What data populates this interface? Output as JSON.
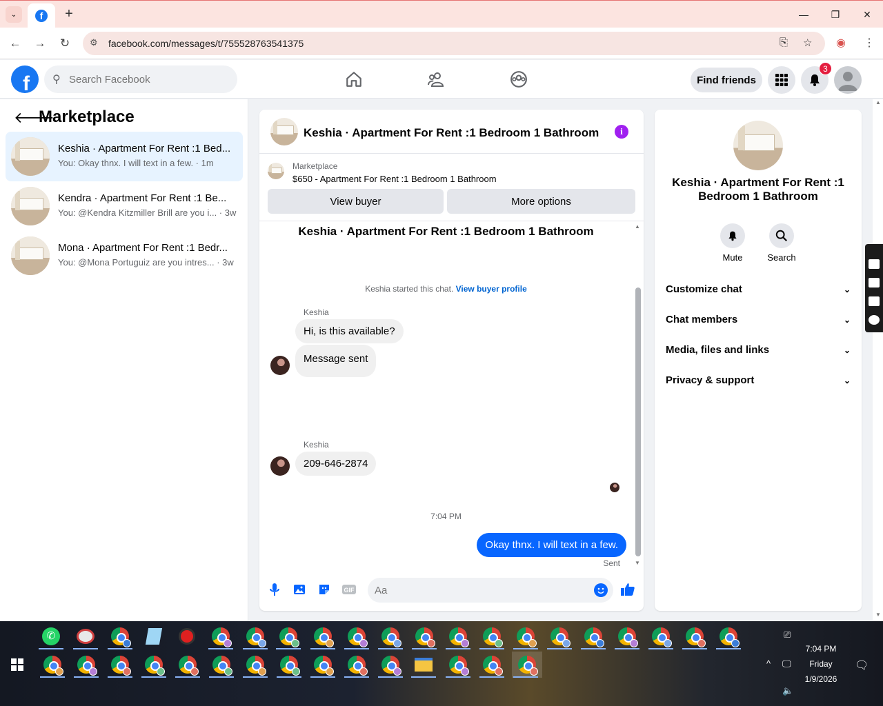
{
  "browser": {
    "url": "facebook.com/messages/t/755528763541375",
    "window_controls": [
      "—",
      "❐",
      "✕"
    ]
  },
  "header": {
    "search_placeholder": "Search Facebook",
    "find_friends": "Find friends",
    "notification_count": "3",
    "icons": [
      "home-icon",
      "friends-icon",
      "groups-icon",
      "menu-grid-icon",
      "bell-icon",
      "avatar"
    ]
  },
  "sidebar": {
    "title": "Marketplace",
    "conversations": [
      {
        "name": "Keshia · Apartment For Rent :1 Bed...",
        "preview": "You: Okay thnx. I will text in a few. · 1m"
      },
      {
        "name": "Kendra · Apartment For Rent :1 Be...",
        "preview": "You: @Kendra Kitzmiller Brill are you i... · 3w"
      },
      {
        "name": "Mona · Apartment For Rent :1 Bedr...",
        "preview": "You: @Mona Portuguiz are you intres... · 3w"
      }
    ]
  },
  "chat": {
    "title": "Keshia · Apartment For Rent :1 Bedroom 1 Bathroom",
    "marketplace_label": "Marketplace",
    "listing": "$650 - Apartment For Rent :1 Bedroom 1 Bathroom",
    "view_buyer": "View buyer",
    "more_options": "More options",
    "conversation_title": "Keshia · Apartment For Rent :1 Bedroom 1 Bathroom",
    "started_text": "Keshia started this chat.",
    "view_buyer_profile": "View buyer profile",
    "sender1": "Keshia",
    "msg1": "Hi, is this available?",
    "msg2": "Message sent",
    "sender2": "Keshia",
    "msg3": "209-646-2874",
    "time": "7:04 PM",
    "msg_out": "Okay thnx. I will text in a few.",
    "status": "Sent",
    "composer_placeholder": "Aa"
  },
  "details": {
    "name": "Keshia · Apartment For Rent :1 Bedroom 1 Bathroom",
    "mute": "Mute",
    "search": "Search",
    "rows": [
      "Customize chat",
      "Chat members",
      "Media, files and links",
      "Privacy & support"
    ]
  },
  "taskbar": {
    "time": "7:04 PM",
    "day": "Friday",
    "date": "1/9/2026"
  },
  "colors": {
    "facebook_blue": "#1877f2",
    "message_blue": "#0866ff",
    "info_purple": "#a020f0",
    "badge_red": "#e41e3f"
  }
}
